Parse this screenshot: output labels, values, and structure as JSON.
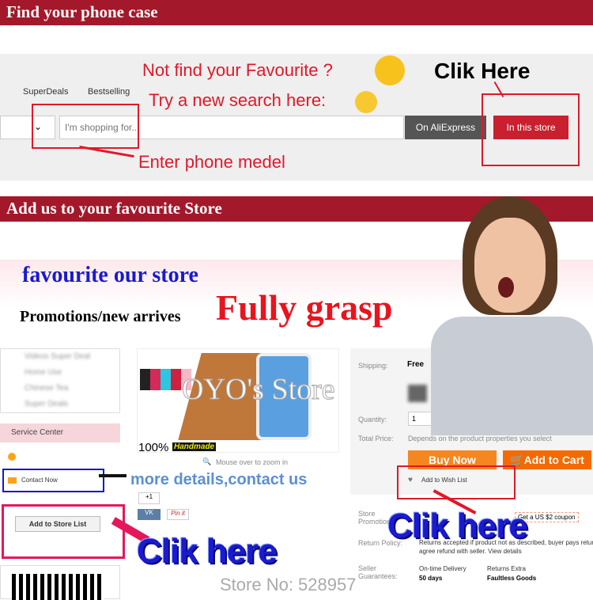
{
  "section1": {
    "title": "Find your phone case",
    "nav": [
      "SuperDeals",
      "Bestselling"
    ],
    "search_placeholder": "I'm shopping for...",
    "btn_aliexpress": "On AliExpress",
    "btn_store": "In this store",
    "note1": "Not find your Favourite ?",
    "note2": "Try a new search here:",
    "clik": "Clik Here",
    "enter": "Enter phone medel"
  },
  "section2": {
    "title": "Add us to your favourite Store",
    "favourite": "favourite our store",
    "promotions": "Promotions/new arrives",
    "grasp": "Fully grasp",
    "sidebar_items": [
      "Videos Super Deal",
      "Home Use",
      "Chinese Tea",
      "Super Deals"
    ],
    "service_center": "Service Center",
    "contact_now": "Contact Now",
    "add_store": "Add to Store List",
    "watermark": "OYO's Store",
    "percent": "100%",
    "handmade": "Handmade",
    "zoom_hint": "Mouse over to zoom in",
    "more_details": "more details,contact us",
    "plus_one": "+1",
    "pinit": "Pin it",
    "clik_left": "Clik here",
    "clik_right": "Clik here",
    "store_no": "Store No: 528957",
    "product": {
      "shipping_label": "Shipping:",
      "shipping": "Free",
      "quantity_label": "Quantity:",
      "quantity": "1",
      "total_label": "Total Price:",
      "total": "Depends on the product properties you select",
      "buy_now": "Buy Now",
      "add_cart": "Add to Cart",
      "wish": "Add to Wish List",
      "promo_label": "Store Promotion:",
      "coupon": "Get a US $2 coupon",
      "return_label": "Return Policy:",
      "return_text": "Returns accepted if product not as described, buyer pays return",
      "return_text2": "agree refund with seller. View details",
      "guarantee_label": "Seller Guarantees:",
      "ontime": "On-time Delivery",
      "days": "50 days",
      "returns": "Returns Extra",
      "faultless": "Faultless Goods"
    }
  },
  "colors": {
    "banner": "#a3182a",
    "red": "#e0182a",
    "orange": "#f56a00",
    "blue": "#1a1ad0"
  }
}
